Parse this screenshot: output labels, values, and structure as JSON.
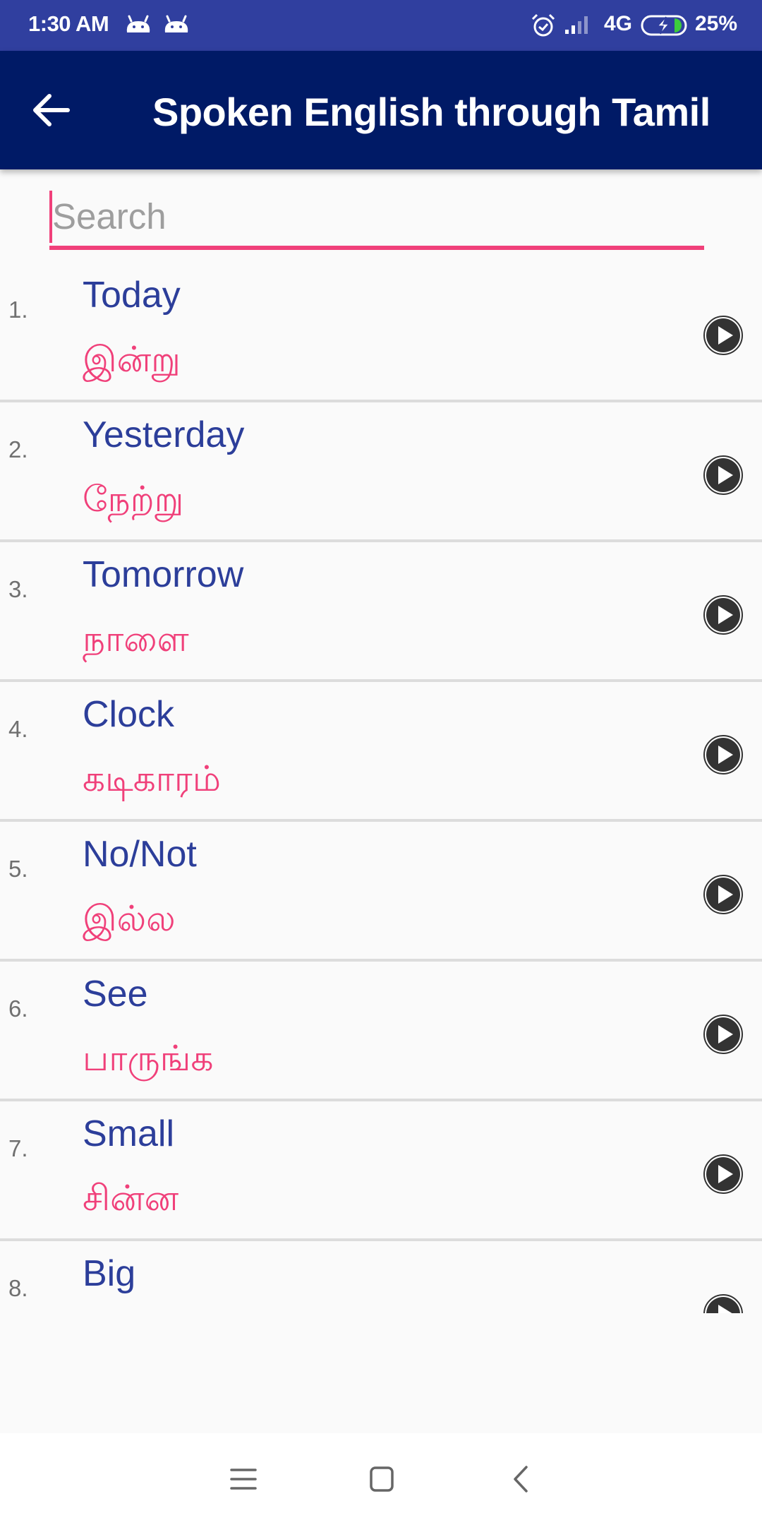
{
  "status_bar": {
    "time": "1:30 AM",
    "notification_icons": [
      "android-notification-icon",
      "android-notification-icon"
    ],
    "alarm_icon": "alarm-clock-icon",
    "signal_icon": "cell-signal-icon",
    "network": "4G",
    "battery_icon": "battery-charging-icon",
    "battery_percent": "25%",
    "battery_level": 0.25
  },
  "app_bar": {
    "back_icon": "arrow-left-icon",
    "title": "Spoken English through Tamil"
  },
  "search": {
    "value": "",
    "placeholder": "Search"
  },
  "list": {
    "items": [
      {
        "number": "1.",
        "english": "Today",
        "tamil": "இன்று"
      },
      {
        "number": "2.",
        "english": "Yesterday",
        "tamil": "நேற்று"
      },
      {
        "number": "3.",
        "english": "Tomorrow",
        "tamil": "நாளை"
      },
      {
        "number": "4.",
        "english": "Clock",
        "tamil": "கடிகாரம்"
      },
      {
        "number": "5.",
        "english": "No/Not",
        "tamil": "இல்ல"
      },
      {
        "number": "6.",
        "english": "See",
        "tamil": "பாருங்க"
      },
      {
        "number": "7.",
        "english": "Small",
        "tamil": "சின்ன"
      },
      {
        "number": "8.",
        "english": "Big",
        "tamil": ""
      }
    ],
    "play_icon": "play-circle-icon"
  },
  "nav_bar": {
    "recents_icon": "menu-lines-icon",
    "home_icon": "square-home-icon",
    "back_icon": "chevron-left-icon"
  },
  "colors": {
    "status_bar": "#303f9f",
    "app_bar": "#001a66",
    "accent": "#f0407a",
    "english_text": "#2c3e9a",
    "background": "#fafafa"
  }
}
